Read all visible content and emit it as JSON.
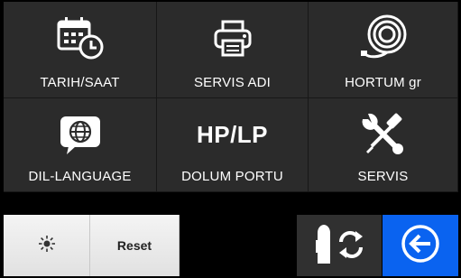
{
  "tiles": [
    {
      "label": "TARIH/SAAT",
      "icon": "calendar-clock-icon"
    },
    {
      "label": "SERVIS ADI",
      "icon": "printer-icon"
    },
    {
      "label": "HORTUM gr",
      "icon": "hose-reel-icon"
    },
    {
      "label": "DIL-LANGUAGE",
      "icon": "globe-speech-bubble-icon"
    },
    {
      "label": "DOLUM PORTU",
      "icon_text": "HP/LP"
    },
    {
      "label": "SERVIS",
      "icon": "wrench-screwdriver-icon"
    }
  ],
  "bottom_bar": {
    "brightness_icon": "brightness-icon",
    "reset_label": "Reset",
    "swap_icon": "tank-swap-icon",
    "back_icon": "back-arrow-icon"
  },
  "colors": {
    "tile_bg": "#2b2b2b",
    "back_button": "#0a63f0",
    "light_button": "#ececec"
  }
}
